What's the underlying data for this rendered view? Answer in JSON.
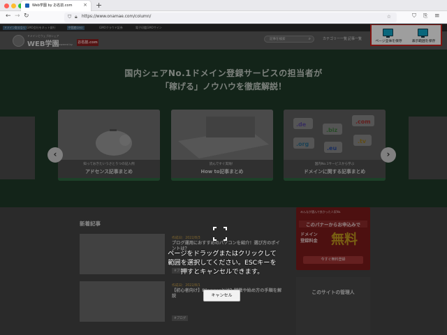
{
  "browser": {
    "tab_title": "Web学園 by お名前.com",
    "url": "https://www.onamae.com/column/",
    "traffic_lights": [
      "#ff5f57",
      "#febc2e",
      "#28c840"
    ]
  },
  "site": {
    "top_links": [
      "GMO会社をネット銀行",
      "GMOクラウド証券",
      "電子印鑑GMOサイン"
    ],
    "top_tags": [
      "ドメイン取るなら",
      "中国産GMO"
    ],
    "logo_small": "ドメインとウェブのシェア",
    "logo": "WEB学園",
    "powered_by": "Powered by",
    "brand": "お名前.com",
    "search_placeholder": "記事を検索",
    "nav": [
      "カテゴリー一覧",
      "記事一覧"
    ]
  },
  "screenshot_tool": {
    "save_full": "ページ全体を保存",
    "save_visible": "表示範囲を保存"
  },
  "hero": {
    "headline1": "国内シェアNo.1ドメイン登録サービスの担当者が",
    "headline2": "「稼げる」ノウハウを徹底解説！",
    "cards": [
      {
        "sub": "知っておきたいうさとりつの記入例",
        "title": "アドセンス記事まとめ"
      },
      {
        "sub": "読んですぐ実践！",
        "title": "How to記事まとめ"
      },
      {
        "sub": "国内No.1サービスから学ぶ",
        "title": "ドメインに関する記事まとめ"
      }
    ],
    "domains": [
      ".de",
      ".biz",
      ".com",
      ".org",
      ".eu",
      ".tv"
    ]
  },
  "main": {
    "section_title": "新着記事",
    "posts": [
      {
        "date": "作成日：2022/8/3",
        "title": "ブログ運用におすすめのパソコンを紹介！選び方のポイントは？",
        "tag": "#ブログ"
      },
      {
        "date": "作成日：2022/8/1",
        "title": "【初心者向け】Bloggerとは？特徴や始め方の手順を解説",
        "tag": "#ブログ"
      }
    ]
  },
  "sidebar": {
    "banner_top": "みんなが選んで良かった人気No.",
    "banner_strip": "このバナーからお申込みで",
    "banner_left": "ドメイン\n登録料金",
    "banner_big": "無料",
    "banner_button": "今すぐ無料登録",
    "box_title": "このサイトの管理人"
  },
  "overlay": {
    "message": "ページをドラッグまたはクリックして範囲を選択してください。ESCキーを押すとキャンセルできます。",
    "cancel": "キャンセル"
  }
}
